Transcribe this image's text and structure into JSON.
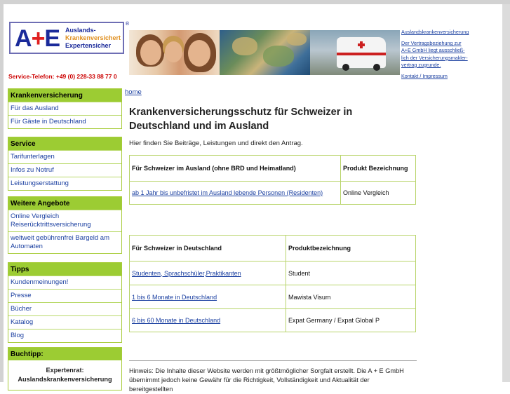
{
  "logo": {
    "ae": "A+E",
    "line1": "Auslands-",
    "line2": "Krankenversichert",
    "line3": "Expertensicher",
    "registered": "®"
  },
  "service_phone": "Service-Telefon: +49 (0) 228-33 88 77 0",
  "header_links": {
    "top": "Auslandskrankenversicherung",
    "disclaimer": [
      "Der Vertragsbeziehung zur",
      "A+E GmbH liegt ausschließ-",
      "lich der Versicherungsmakler-",
      "vertrag zugrunde."
    ],
    "contact": "Kontakt / Impressum"
  },
  "nav": [
    {
      "title": "Krankenversicherung",
      "items": [
        "Für das Ausland",
        "Für Gäste in Deutschland"
      ]
    },
    {
      "title": "Service",
      "items": [
        "Tarifunterlagen",
        "Infos zu Notruf",
        "Leistungserstattung"
      ]
    },
    {
      "title": "Weitere Angebote",
      "items": [
        "Online Vergleich Reiserücktrittsversicherung",
        "weltweit gebührenfrei Bargeld am Automaten"
      ]
    },
    {
      "title": "Tipps",
      "items": [
        "Kundenmeinungen!",
        "Presse",
        "Bücher",
        "Katalog",
        "Blog"
      ]
    }
  ],
  "buchtipp": {
    "title": "Buchtipp:",
    "line1": "Expertenrat:",
    "line2": "Auslandskrankenversicherung"
  },
  "breadcrumb": "home",
  "heading": "Krankenversicherungsschutz für Schweizer in Deutschland und im Ausland",
  "intro": "Hier finden Sie Beiträge, Leistungen und direkt den Antrag.",
  "table1": {
    "headers": [
      "Für Schweizer im Ausland (ohne BRD und Heimatland)",
      "Produkt Bezeichnung"
    ],
    "rows": [
      [
        "ab 1 Jahr bis unbefristet im Ausland lebende Personen (Residenten)",
        "Online Vergleich"
      ]
    ]
  },
  "table2": {
    "headers": [
      "Für Schweizer in Deutschland",
      "Produktbezeichnung"
    ],
    "rows": [
      [
        "Studenten, Sprachschüler,Praktikanten",
        "Student"
      ],
      [
        "1 bis 6 Monate in Deutschland",
        "Mawista Visum"
      ],
      [
        "6 bis 60 Monate in Deutschland",
        "Expat Germany / Expat Global P"
      ]
    ]
  },
  "note": "Hinweis: Die Inhalte dieser Website werden mit größtmöglicher Sorgfalt erstellt. Die A + E GmbH übernimmt jedoch keine Gewähr für die Richtigkeit, Vollständigkeit und Aktualität der bereitgestellten"
}
